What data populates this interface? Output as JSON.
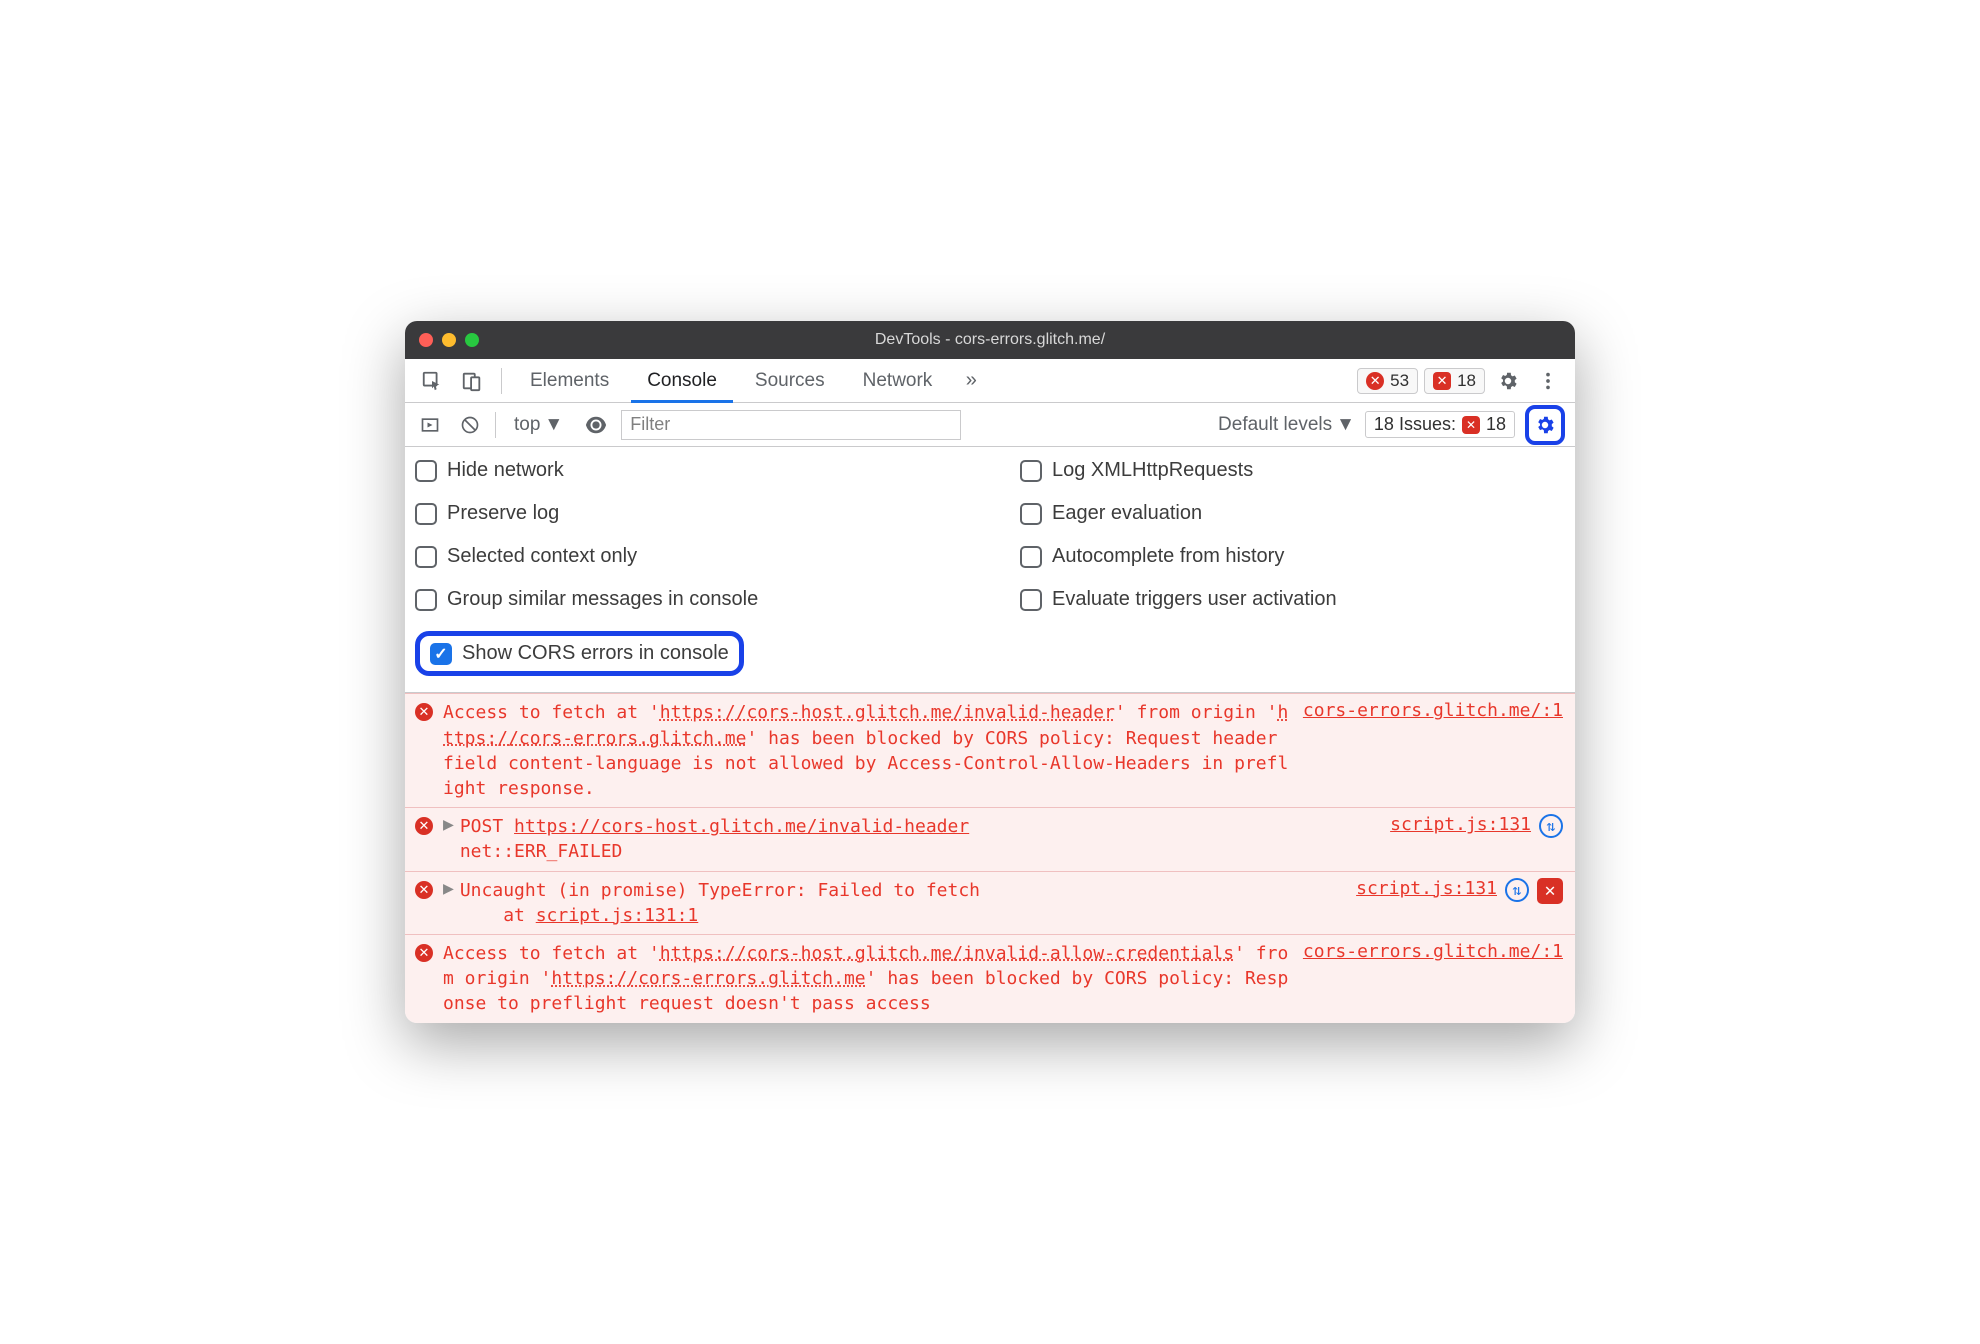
{
  "window": {
    "title": "DevTools - cors-errors.glitch.me/"
  },
  "tabs": {
    "elements": "Elements",
    "console": "Console",
    "sources": "Sources",
    "network": "Network"
  },
  "counters": {
    "errors": "53",
    "issues": "18"
  },
  "toolbar": {
    "context": "top",
    "filter_placeholder": "Filter",
    "levels": "Default levels",
    "issues_label": "18 Issues:",
    "issues_count": "18"
  },
  "settings": {
    "hide_network": "Hide network",
    "log_xhr": "Log XMLHttpRequests",
    "preserve_log": "Preserve log",
    "eager_eval": "Eager evaluation",
    "selected_context": "Selected context only",
    "autocomplete": "Autocomplete from history",
    "group_similar": "Group similar messages in console",
    "eval_triggers": "Evaluate triggers user activation",
    "show_cors": "Show CORS errors in console"
  },
  "messages": {
    "m1_pre": "Access to fetch at '",
    "m1_url": "https://cors-host.glitch.me/invalid-header",
    "m1_mid": "' from origin '",
    "m1_origin": "https://cors-errors.glitch.me",
    "m1_post": "' has been blocked by CORS policy: Request header field content-language is not allowed by Access-Control-Allow-Headers in preflight response.",
    "m1_src": "cors-errors.glitch.me/:1",
    "m2_method": "POST",
    "m2_url": "https://cors-host.glitch.me/invalid-header",
    "m2_err": "net::ERR_FAILED",
    "m2_src": "script.js:131",
    "m3_err": "Uncaught (in promise) TypeError: Failed to fetch",
    "m3_at": "at ",
    "m3_loc": "script.js:131:1",
    "m3_src": "script.js:131",
    "m4_pre": "Access to fetch at '",
    "m4_url": "https://cors-host.glitch.me/invalid-allow-credentials",
    "m4_mid": "' from origin '",
    "m4_origin": "https://cors-errors.glitch.me",
    "m4_post": "' has been blocked by CORS policy: Response to preflight request doesn't pass access",
    "m4_src": "cors-errors.glitch.me/:1"
  }
}
